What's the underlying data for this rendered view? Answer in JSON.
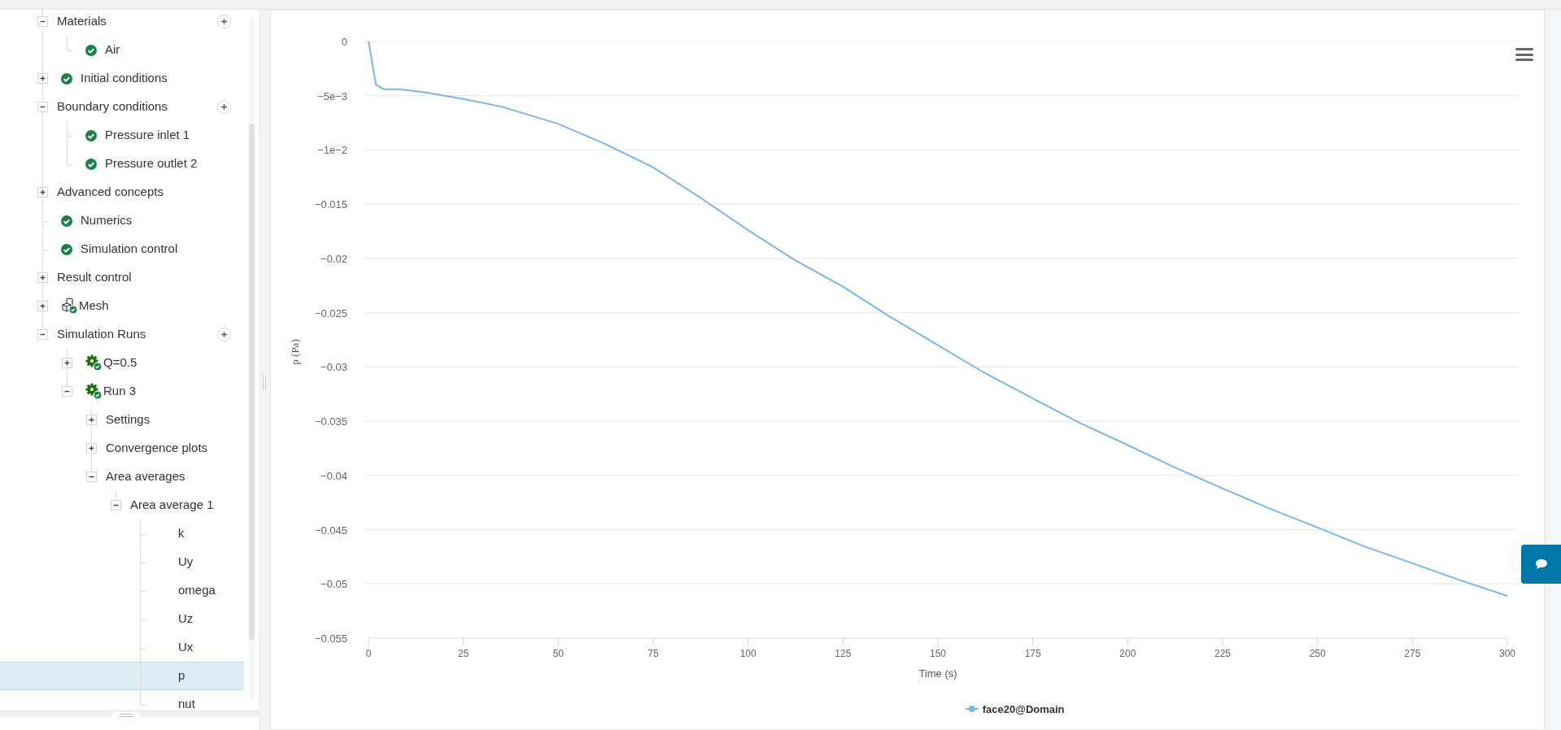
{
  "tree": [
    {
      "label": "Materials",
      "kind": "group",
      "expanded": true,
      "add": true,
      "selected": false,
      "children": [
        {
          "label": "Air",
          "kind": "item",
          "selected": false
        }
      ]
    },
    {
      "label": "Initial conditions",
      "kind": "item",
      "expanded": false,
      "selected": false
    },
    {
      "label": "Boundary conditions",
      "kind": "group",
      "expanded": true,
      "add": true,
      "selected": false,
      "children": [
        {
          "label": "Pressure inlet 1",
          "kind": "item",
          "selected": false
        },
        {
          "label": "Pressure outlet 2",
          "kind": "item",
          "selected": false
        }
      ]
    },
    {
      "label": "Advanced concepts",
      "kind": "group",
      "expanded": false,
      "selected": false
    },
    {
      "label": "Numerics",
      "kind": "item",
      "selected": false
    },
    {
      "label": "Simulation control",
      "kind": "item",
      "selected": false
    },
    {
      "label": "Result control",
      "kind": "group",
      "expanded": false,
      "selected": false
    },
    {
      "label": "Mesh",
      "kind": "mesh",
      "expanded": false,
      "selected": false
    },
    {
      "label": "Simulation Runs",
      "kind": "group",
      "expanded": true,
      "add": true,
      "selected": false,
      "children": [
        {
          "label": "Q=0.5",
          "kind": "run",
          "expanded": false,
          "selected": false
        },
        {
          "label": "Run 3",
          "kind": "run",
          "expanded": true,
          "selected": false,
          "children": [
            {
              "label": "Settings",
              "kind": "group",
              "expanded": false,
              "selected": false
            },
            {
              "label": "Convergence plots",
              "kind": "group",
              "expanded": false,
              "selected": false
            },
            {
              "label": "Area averages",
              "kind": "group",
              "expanded": true,
              "selected": false,
              "children": [
                {
                  "label": "Area average 1",
                  "kind": "group",
                  "expanded": true,
                  "selected": false,
                  "children": [
                    {
                      "label": "k",
                      "kind": "field",
                      "selected": false
                    },
                    {
                      "label": "Uy",
                      "kind": "field",
                      "selected": false
                    },
                    {
                      "label": "omega",
                      "kind": "field",
                      "selected": false
                    },
                    {
                      "label": "Uz",
                      "kind": "field",
                      "selected": false
                    },
                    {
                      "label": "Ux",
                      "kind": "field",
                      "selected": false
                    },
                    {
                      "label": "p",
                      "kind": "field",
                      "selected": true
                    },
                    {
                      "label": "nut",
                      "kind": "field",
                      "selected": false
                    }
                  ]
                }
              ]
            }
          ]
        }
      ]
    }
  ],
  "chart": {
    "chart_data": {
      "type": "line",
      "grid": true,
      "xlabel": "Time (s)",
      "ylabel": "p (Pa)",
      "x": [
        0,
        2,
        4,
        6,
        8,
        15,
        25,
        35,
        50,
        62,
        75,
        87,
        100,
        112,
        125,
        137,
        150,
        162,
        175,
        187,
        200,
        212,
        225,
        237,
        250,
        262,
        275,
        287,
        300
      ],
      "series": [
        {
          "name": "face20@Domain",
          "color": "#7cb5ec",
          "values": [
            0,
            -0.004,
            -0.0044,
            -0.0044,
            -0.0044,
            -0.0047,
            -0.0053,
            -0.006,
            -0.0076,
            -0.0094,
            -0.0116,
            -0.0143,
            -0.0174,
            -0.0201,
            -0.0226,
            -0.0253,
            -0.028,
            -0.0305,
            -0.0329,
            -0.0351,
            -0.0372,
            -0.0392,
            -0.0412,
            -0.043,
            -0.0448,
            -0.0465,
            -0.0481,
            -0.0496,
            -0.0511
          ]
        }
      ],
      "xlim": [
        0,
        300
      ],
      "ylim": [
        -0.055,
        0
      ],
      "xticks": [
        0,
        25,
        50,
        75,
        100,
        125,
        150,
        175,
        200,
        225,
        250,
        275,
        300
      ],
      "yticks": [
        {
          "value": 0,
          "label": "0"
        },
        {
          "value": -0.005,
          "label": "−5e−3"
        },
        {
          "value": -0.01,
          "label": "−1e−2"
        },
        {
          "value": -0.015,
          "label": "−0.015"
        },
        {
          "value": -0.02,
          "label": "−0.02"
        },
        {
          "value": -0.025,
          "label": "−0.025"
        },
        {
          "value": -0.03,
          "label": "−0.03"
        },
        {
          "value": -0.035,
          "label": "−0.035"
        },
        {
          "value": -0.04,
          "label": "−0.04"
        },
        {
          "value": -0.045,
          "label": "−0.045"
        },
        {
          "value": -0.05,
          "label": "−0.05"
        },
        {
          "value": -0.055,
          "label": "−0.055"
        }
      ]
    }
  }
}
